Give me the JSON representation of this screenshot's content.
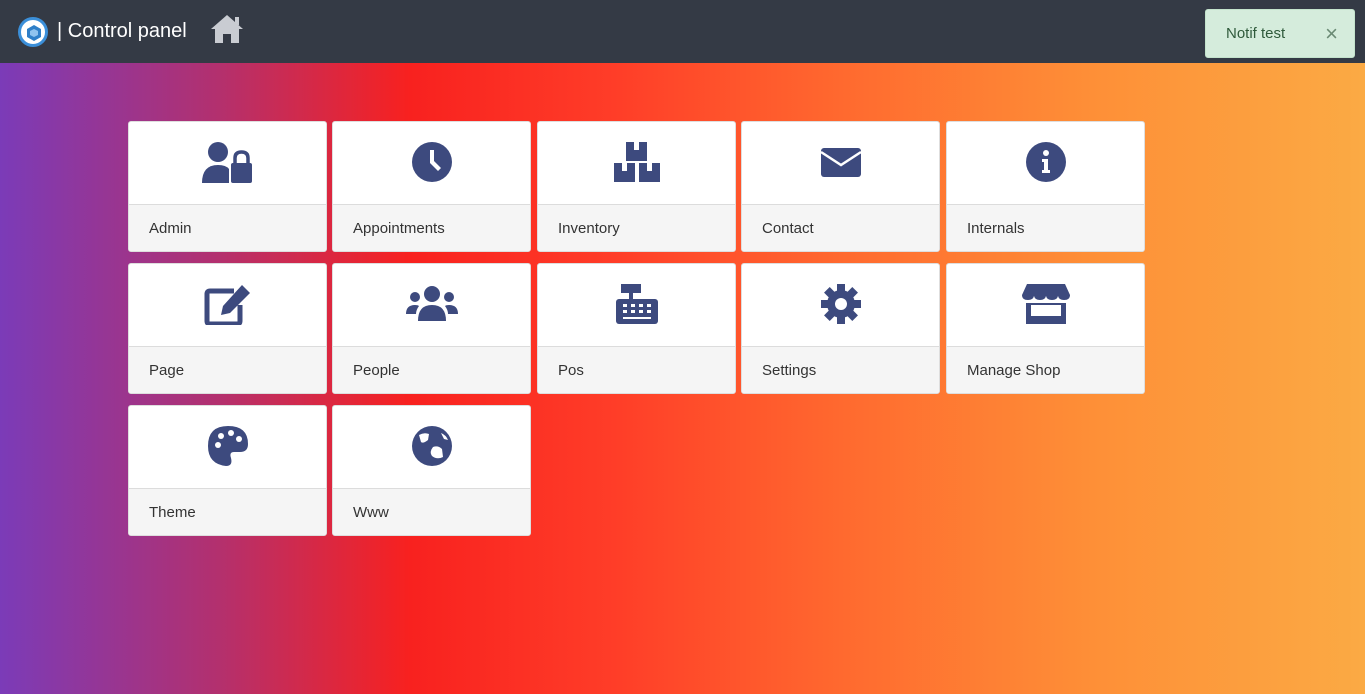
{
  "header": {
    "brand_text": "| Control panel",
    "icons": {
      "logo": "app-logo-icon",
      "home": "home-icon"
    },
    "bg_color": "#343a45"
  },
  "notification": {
    "text": "Notif test",
    "close_label": "×",
    "bg_color": "#d5ecdc"
  },
  "tiles": [
    {
      "label": "Admin",
      "icon": "user-lock-icon"
    },
    {
      "label": "Appointments",
      "icon": "clock-icon"
    },
    {
      "label": "Inventory",
      "icon": "boxes-icon"
    },
    {
      "label": "Contact",
      "icon": "envelope-icon"
    },
    {
      "label": "Internals",
      "icon": "info-circle-icon"
    },
    {
      "label": "Page",
      "icon": "edit-icon"
    },
    {
      "label": "People",
      "icon": "users-icon"
    },
    {
      "label": "Pos",
      "icon": "cash-register-icon"
    },
    {
      "label": "Settings",
      "icon": "cog-icon"
    },
    {
      "label": "Manage Shop",
      "icon": "store-icon"
    },
    {
      "label": "Theme",
      "icon": "palette-icon"
    },
    {
      "label": "Www",
      "icon": "globe-icon"
    }
  ],
  "colors": {
    "icon": "#3d4a7e"
  }
}
